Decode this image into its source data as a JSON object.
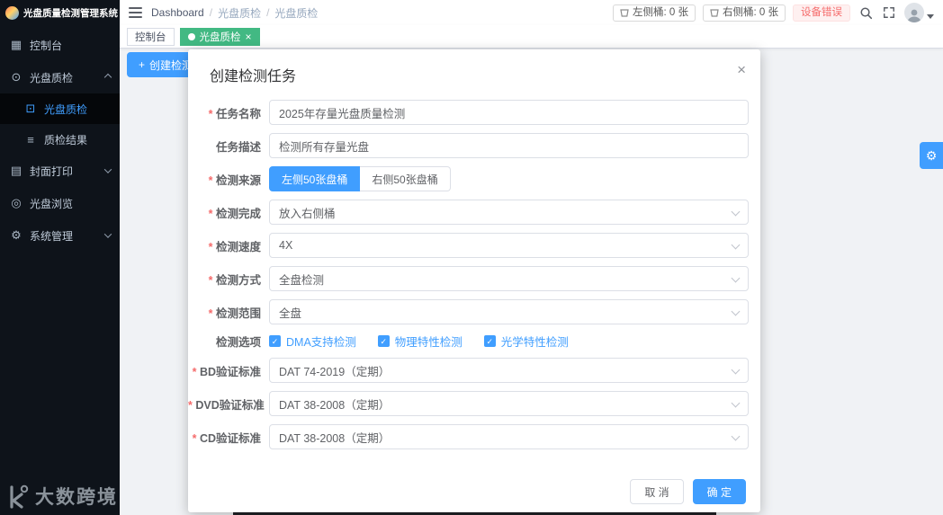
{
  "app": {
    "title": "光盘质量检测管理系统"
  },
  "sidebar": {
    "items": [
      {
        "label": "控制台",
        "icon": "▦"
      },
      {
        "label": "光盘质检",
        "icon": "⊙",
        "children": [
          {
            "label": "光盘质检",
            "icon": "⊡"
          },
          {
            "label": "质检结果",
            "icon": "≡"
          }
        ]
      },
      {
        "label": "封面打印",
        "icon": "▤"
      },
      {
        "label": "光盘浏览",
        "icon": "◎"
      },
      {
        "label": "系统管理",
        "icon": "⚙"
      }
    ]
  },
  "header": {
    "breadcrumb": [
      "Dashboard",
      "光盘质检",
      "光盘质检"
    ],
    "breadcrumb_separator": "/",
    "left_bucket_badge": "左侧桶: 0 张",
    "right_bucket_badge": "右侧桶: 0 张",
    "device_error_badge": "设备错误"
  },
  "tabs": {
    "items": [
      {
        "label": "控制台"
      },
      {
        "label": "光盘质检"
      }
    ]
  },
  "content": {
    "create_task_button": "创建检测任务"
  },
  "dialog": {
    "title": "创建检测任务",
    "fields": [
      {
        "label": "任务名称",
        "required": true,
        "type": "input",
        "value": "2025年存量光盘质量检测"
      },
      {
        "label": "任务描述",
        "required": false,
        "type": "input",
        "value": "检测所有存量光盘"
      },
      {
        "label": "检测来源",
        "required": true,
        "type": "radio",
        "options": [
          "左侧50张盘桶",
          "右侧50张盘桶"
        ],
        "selected": "左侧50张盘桶"
      },
      {
        "label": "检测完成",
        "required": true,
        "type": "select",
        "value": "放入右侧桶"
      },
      {
        "label": "检测速度",
        "required": true,
        "type": "select",
        "value": "4X"
      },
      {
        "label": "检测方式",
        "required": true,
        "type": "select",
        "value": "全盘检测"
      },
      {
        "label": "检测范围",
        "required": true,
        "type": "select",
        "value": "全盘"
      },
      {
        "label": "检测选项",
        "required": false,
        "type": "checkbox",
        "options": [
          "DMA支持检测",
          "物理特性检测",
          "光学特性检测"
        ],
        "checked": [
          true,
          true,
          true
        ]
      },
      {
        "label": "BD验证标准",
        "required": true,
        "type": "select",
        "value": "DAT 74-2019（定期）"
      },
      {
        "label": "DVD验证标准",
        "required": true,
        "type": "select",
        "value": "DAT 38-2008（定期）"
      },
      {
        "label": "CD验证标准",
        "required": true,
        "type": "select",
        "value": "DAT 38-2008（定期）"
      }
    ],
    "footer": {
      "cancel": "取 消",
      "confirm": "确 定"
    }
  },
  "watermark": "大数跨境",
  "icons": {
    "plus": "+",
    "close": "×",
    "check": "✓",
    "gear": "⚙"
  },
  "colors": {
    "primary": "#409eff",
    "tab_active": "#42b983",
    "danger": "#f56c6c",
    "sidebar_bg": "#0e131a"
  }
}
